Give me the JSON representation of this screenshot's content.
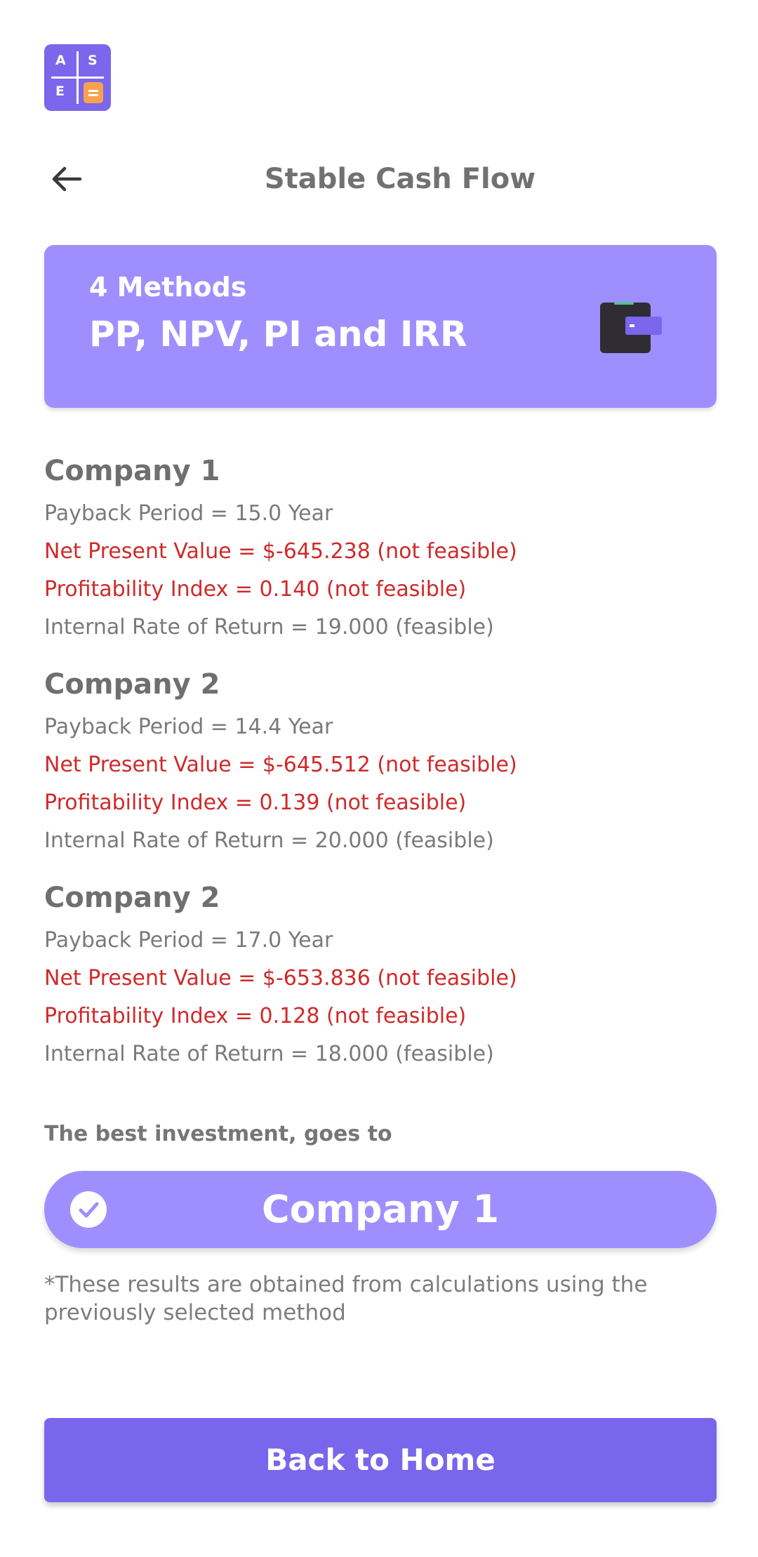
{
  "app": {
    "logo_letters": [
      "A",
      "S",
      "E"
    ],
    "logo_icon": "calculator-logo-icon",
    "accent_color": "#7a66ec",
    "light_accent_color": "#9f8ffe",
    "warning_color": "#cf2a2a"
  },
  "header": {
    "back_icon": "arrow-left-icon",
    "title": "Stable Cash Flow"
  },
  "banner": {
    "subtitle": "4 Methods",
    "title": "PP, NPV, PI and IRR",
    "icon": "wallet-icon"
  },
  "companies": [
    {
      "name": "Company 1",
      "pp": "Payback Period = 15.0 Year",
      "npv": "Net Present Value = $-645.238 (not feasible)",
      "pi": "Profitability Index = 0.140 (not feasible)",
      "irr": "Internal Rate of Return = 19.000 (feasible)"
    },
    {
      "name": "Company 2",
      "pp": "Payback Period = 14.4 Year",
      "npv": "Net Present Value = $-645.512 (not feasible)",
      "pi": "Profitability Index = 0.139 (not feasible)",
      "irr": "Internal Rate of Return = 20.000 (feasible)"
    },
    {
      "name": "Company 2",
      "pp": "Payback Period = 17.0 Year",
      "npv": "Net Present Value = $-653.836 (not feasible)",
      "pi": "Profitability Index = 0.128 (not feasible)",
      "irr": "Internal Rate of Return = 18.000 (feasible)"
    }
  ],
  "result": {
    "label": "The best investment, goes to",
    "winner": "Company 1",
    "icon": "check-circle-icon",
    "note": "*These results are obtained from calculations using the previously selected method"
  },
  "footer": {
    "home_button": "Back to Home"
  }
}
